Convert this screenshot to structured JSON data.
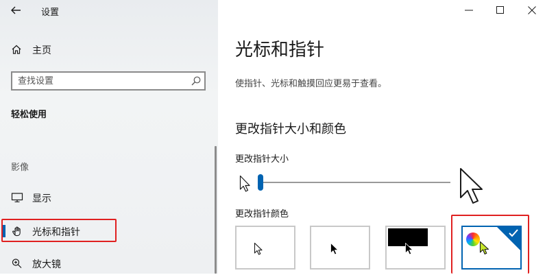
{
  "window": {
    "app_title": "设置",
    "controls": {
      "minimize": "minimize-icon",
      "maximize": "maximize-icon",
      "close": "close-icon"
    }
  },
  "sidebar": {
    "home_label": "主页",
    "search": {
      "placeholder": "查找设置",
      "value": ""
    },
    "section": "轻松使用",
    "group_label": "影像",
    "items": [
      {
        "label": "显示",
        "icon": "monitor-icon",
        "selected": false
      },
      {
        "label": "光标和指针",
        "icon": "pointer-hand-icon",
        "selected": true
      },
      {
        "label": "放大镜",
        "icon": "magnifier-icon",
        "selected": false
      }
    ]
  },
  "main": {
    "title": "光标和指针",
    "description": "使指针、光标和触摸回应更易于查看。",
    "subheading": "更改指针大小和颜色",
    "size_label": "更改指针大小",
    "size_slider": {
      "min": 1,
      "max": 15,
      "value": 1
    },
    "color_label": "更改指针颜色",
    "color_options": [
      {
        "name": "white",
        "selected": false
      },
      {
        "name": "black",
        "selected": false
      },
      {
        "name": "inverted",
        "selected": false
      },
      {
        "name": "custom",
        "selected": true
      }
    ]
  },
  "colors": {
    "accent": "#0063b1",
    "highlight": "#e02020"
  }
}
